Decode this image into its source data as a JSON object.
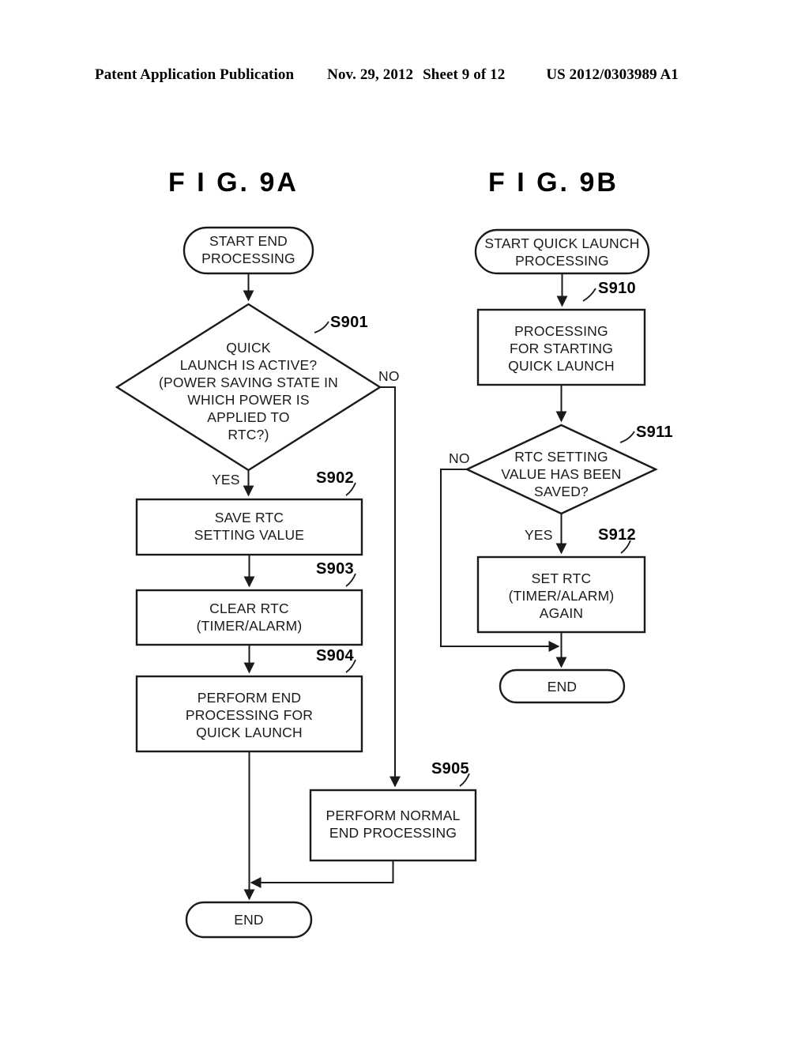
{
  "header": {
    "title": "Patent Application Publication",
    "date": "Nov. 29, 2012",
    "sheet": "Sheet 9 of 12",
    "number": "US 2012/0303989 A1"
  },
  "figures": [
    {
      "caption": "F I G.  9A",
      "nodes": {
        "start": "START END\nPROCESSING",
        "s901": "QUICK\nLAUNCH IS ACTIVE?\n(POWER SAVING STATE IN\nWHICH POWER IS\nAPPLIED TO\nRTC?)",
        "s902": "SAVE RTC\nSETTING VALUE",
        "s903": "CLEAR RTC\n(TIMER/ALARM)",
        "s904": "PERFORM END\nPROCESSING FOR\nQUICK LAUNCH",
        "s905": "PERFORM NORMAL\nEND PROCESSING",
        "end": "END"
      },
      "step_labels": {
        "s901": "S901",
        "s902": "S902",
        "s903": "S903",
        "s904": "S904",
        "s905": "S905"
      },
      "branch_labels": {
        "yes": "YES",
        "no": "NO"
      }
    },
    {
      "caption": "F I G.  9B",
      "nodes": {
        "start": "START QUICK LAUNCH\nPROCESSING",
        "s910": "PROCESSING\nFOR STARTING\nQUICK LAUNCH",
        "s911": "RTC SETTING\nVALUE HAS BEEN\nSAVED?",
        "s912": "SET RTC\n(TIMER/ALARM)\nAGAIN",
        "end": "END"
      },
      "step_labels": {
        "s910": "S910",
        "s911": "S911",
        "s912": "S912"
      },
      "branch_labels": {
        "yes": "YES",
        "no": "NO"
      }
    }
  ],
  "colors": {
    "ink": "#1a1a1a",
    "paper": "#ffffff"
  }
}
